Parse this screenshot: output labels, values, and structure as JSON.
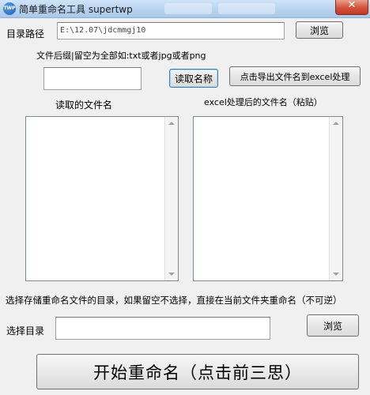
{
  "window": {
    "title": "简单重命名工具 supertwp",
    "icon_text": "TWP",
    "close_glyph": "✕"
  },
  "directory": {
    "label": "目录路径",
    "value": "E:\\12.07\\jdcmmgj10",
    "browse_label": "浏览"
  },
  "suffix": {
    "hint": "文件后缀|留空为全部如:txt或者jpg或者png",
    "value": "",
    "read_button": "读取名称",
    "export_button": "点击导出文件名到excel处理"
  },
  "lists": {
    "read_header": "读取的文件名",
    "excel_header": "excel处理后的文件名（粘贴）"
  },
  "save": {
    "note": "选择存储重命名文件的目录，如果留空不选择，直接在当前文件夹重命名（不可逆）",
    "label": "选择目录",
    "value": "",
    "browse_label": "浏览"
  },
  "start_button": "开始重命名（点击前三思）"
}
